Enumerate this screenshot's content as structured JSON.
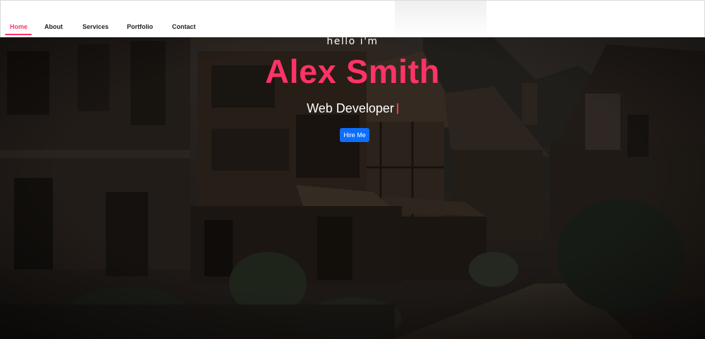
{
  "nav": {
    "items": [
      {
        "label": "Home",
        "active": true
      },
      {
        "label": "About",
        "active": false
      },
      {
        "label": "Services",
        "active": false
      },
      {
        "label": "Portfolio",
        "active": false
      },
      {
        "label": "Contact",
        "active": false
      }
    ]
  },
  "hero": {
    "greeting": "hello i'm",
    "name": "Alex Smith",
    "role": "Web Developer",
    "cta_label": "Hire Me"
  },
  "colors": {
    "accent": "#ff3366",
    "button": "#0d6efd",
    "nav_bg": "#ffffff",
    "nav_text": "#222222"
  }
}
